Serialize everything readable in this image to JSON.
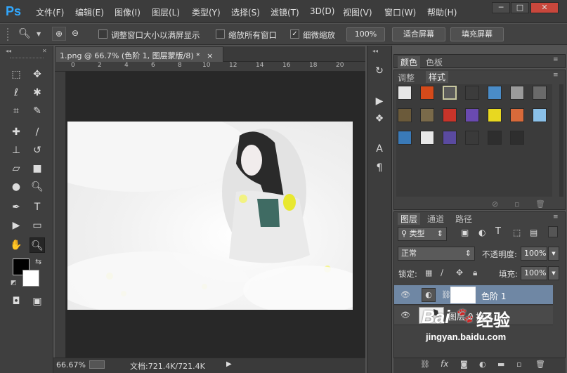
{
  "app": {
    "logo": "Ps"
  },
  "menu": [
    "文件(F)",
    "编辑(E)",
    "图像(I)",
    "图层(L)",
    "类型(Y)",
    "选择(S)",
    "滤镜(T)",
    "3D(D)",
    "视图(V)",
    "窗口(W)",
    "帮助(H)"
  ],
  "window_controls": {
    "minimize": "─",
    "restore": "□",
    "close": "✕"
  },
  "options": {
    "resize_windows_label": "调整窗口大小以满屏显示",
    "zoom_all_label": "缩放所有窗口",
    "scrubby_zoom_label": "细微缩放",
    "scrubby_zoom_checked": true,
    "zoom_100": "100%",
    "fit_screen": "适合屏幕",
    "fill_screen": "填充屏幕"
  },
  "document": {
    "tab_title": "1.png @ 66.7% (色阶 1, 图层蒙版/8) *",
    "tab_close": "×",
    "ruler_marks": [
      "0",
      "2",
      "4",
      "6",
      "8",
      "10",
      "12",
      "14",
      "16",
      "18",
      "20"
    ]
  },
  "status": {
    "zoom": "66.67%",
    "doc_info": "文档:721.4K/721.4K"
  },
  "color_panel": {
    "tabs": [
      "颜色",
      "色板"
    ]
  },
  "styles_panel": {
    "tabs": [
      "调整",
      "样式"
    ],
    "swatches": [
      "#e6e6e6",
      "#d44a1a",
      "#5a5a5a",
      "#3c3c3c",
      "#4a8cc8",
      "#9a9a9a",
      "#6a6a6a",
      "#6b5a3a",
      "#7a6a4a",
      "#c8342a",
      "#6a4ab0",
      "#e8d820",
      "#d86a3a",
      "#8ac0e8",
      "#3a7ab8",
      "#e8e8e8",
      "#5a4aa0",
      "#3a3a3a",
      "#2e2e2e",
      "#2e2e2e"
    ]
  },
  "layers_panel": {
    "tabs": [
      "图层",
      "通道",
      "路径"
    ],
    "filter_label": "类型",
    "blend_mode": "正常",
    "opacity_label": "不透明度:",
    "opacity_value": "100%",
    "lock_label": "锁定:",
    "fill_label": "填充:",
    "fill_value": "100%",
    "layers": [
      {
        "name": "色阶 1",
        "selected": true
      },
      {
        "name": "图层 0 拷贝 3",
        "selected": false
      }
    ]
  },
  "watermark": {
    "brand": "Bai",
    "brand_suffix": "经验",
    "url": "jingyan.baidu.com"
  },
  "colors": {
    "accent": "#31a8ff",
    "selected_layer": "#6f87a4",
    "bg": "#535353"
  }
}
